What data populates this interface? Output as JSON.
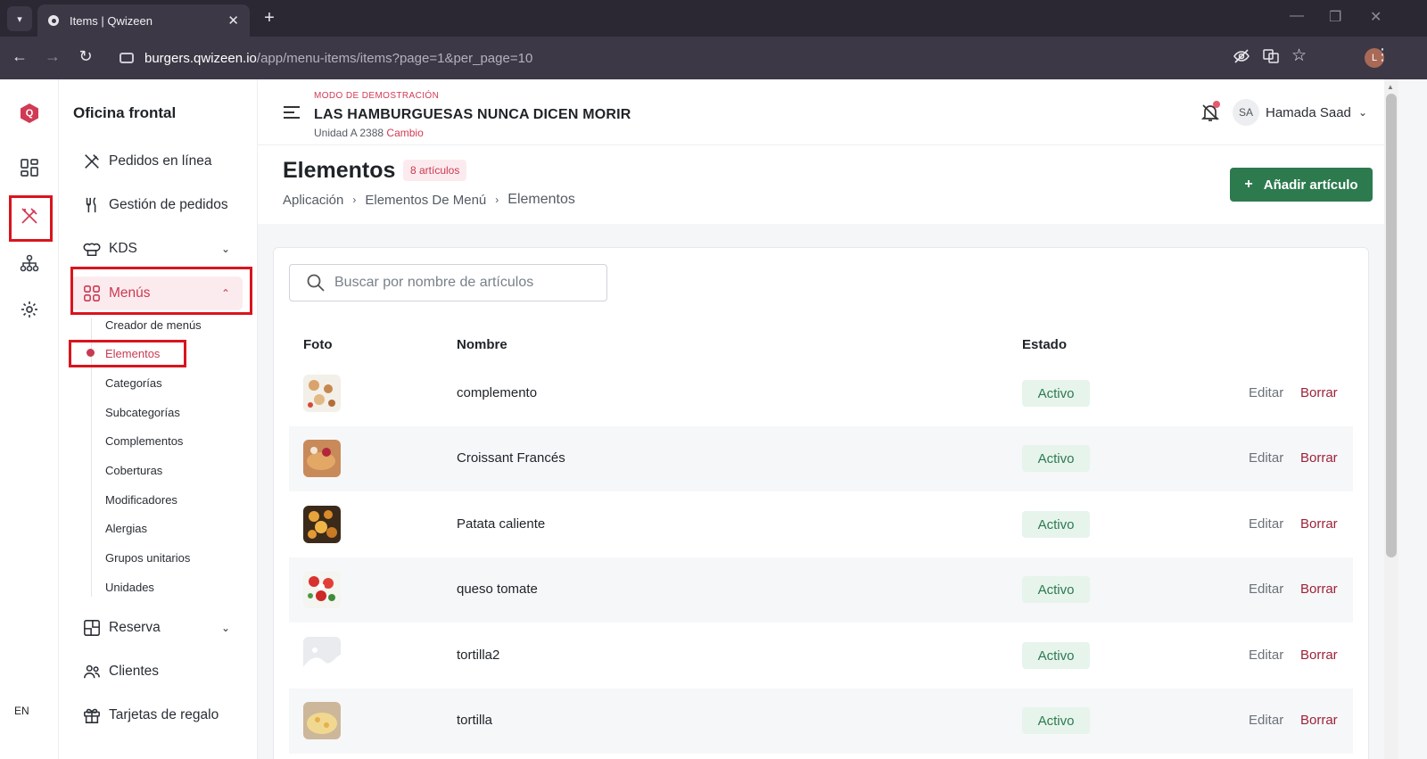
{
  "browser": {
    "tab_title": "Items | Qwizeen",
    "url_host": "burgers.qwizeen.io",
    "url_path": "/app/menu-items/items?page=1&per_page=10",
    "profile_initial": "L"
  },
  "sidenav": {
    "title": "Oficina frontal",
    "items": [
      {
        "label": "Pedidos en línea"
      },
      {
        "label": "Gestión de pedidos"
      },
      {
        "label": "KDS"
      },
      {
        "label": "Menús"
      },
      {
        "label": "Reserva"
      },
      {
        "label": "Clientes"
      },
      {
        "label": "Tarjetas de regalo"
      }
    ],
    "menu_sub": [
      {
        "label": "Creador de menús"
      },
      {
        "label": "Elementos"
      },
      {
        "label": "Categorías"
      },
      {
        "label": "Subcategorías"
      },
      {
        "label": "Complementos"
      },
      {
        "label": "Coberturas"
      },
      {
        "label": "Modificadores"
      },
      {
        "label": "Alergias"
      },
      {
        "label": "Grupos unitarios"
      },
      {
        "label": "Unidades"
      }
    ]
  },
  "rail": {
    "lang": "EN"
  },
  "topbar": {
    "demo_label": "MODO DE DEMOSTRACIÓN",
    "store_name": "LAS HAMBURGUESAS NUNCA DICEN MORIR",
    "unit": "Unidad A 2388",
    "change": "Cambio",
    "user_initials": "SA",
    "user_name": "Hamada Saad"
  },
  "page": {
    "title": "Elementos",
    "count_badge": "8 artículos",
    "breadcrumb": [
      "Aplicación",
      "Elementos De Menú",
      "Elementos"
    ],
    "add_button": "Añadir artículo",
    "search_placeholder": "Buscar por nombre de artículos"
  },
  "table": {
    "headers": {
      "photo": "Foto",
      "name": "Nombre",
      "status": "Estado"
    },
    "rows": [
      {
        "name": "complemento",
        "status": "Activo",
        "edit": "Editar",
        "delete": "Borrar"
      },
      {
        "name": "Croissant Francés",
        "status": "Activo",
        "edit": "Editar",
        "delete": "Borrar"
      },
      {
        "name": "Patata caliente",
        "status": "Activo",
        "edit": "Editar",
        "delete": "Borrar"
      },
      {
        "name": "queso tomate",
        "status": "Activo",
        "edit": "Editar",
        "delete": "Borrar"
      },
      {
        "name": "tortilla2",
        "status": "Activo",
        "edit": "Editar",
        "delete": "Borrar"
      },
      {
        "name": "tortilla",
        "status": "Activo",
        "edit": "Editar",
        "delete": "Borrar"
      }
    ]
  },
  "colors": {
    "brand": "#d13a54",
    "primary_button": "#2d7a4f",
    "active_status_bg": "#e6f4ec",
    "delete_link": "#9c2238",
    "annotation_box": "#d9141d"
  }
}
